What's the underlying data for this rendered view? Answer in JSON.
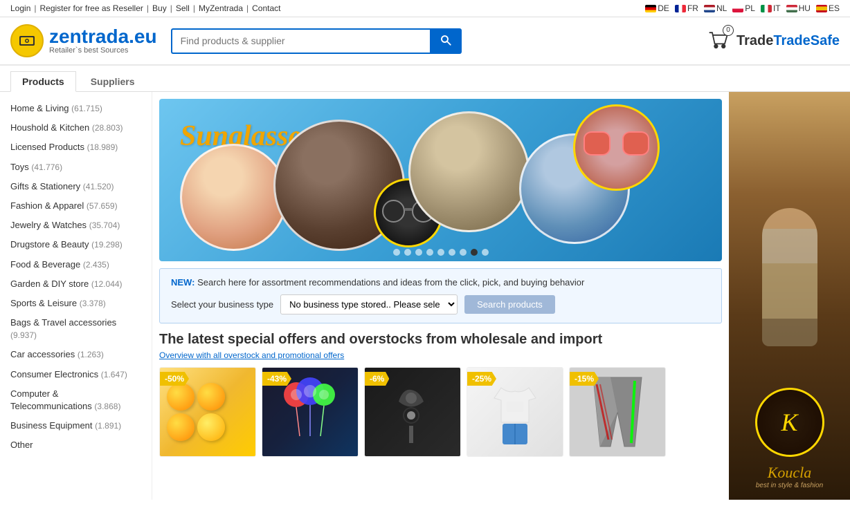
{
  "topbar": {
    "links": [
      "Login",
      "Register for free as Reseller",
      "Buy",
      "Sell",
      "MyZentrada",
      "Contact"
    ],
    "separators": [
      "|",
      "|",
      "|",
      "|",
      "|"
    ],
    "langs": [
      {
        "code": "DE",
        "flag_color": "#000 #dd0000 #ffcc00"
      },
      {
        "code": "FR",
        "flag_color": "#002395 #fff #ed2939"
      },
      {
        "code": "NL",
        "flag_color": "#ae1c28 #fff #21468b"
      },
      {
        "code": "PL",
        "flag_color": "#fff #dc143c"
      },
      {
        "code": "IT",
        "flag_color": "#009246 #fff #ce2b37"
      },
      {
        "code": "HU",
        "flag_color": "#ce2939 #fff #436f4d"
      },
      {
        "code": "ES",
        "flag_color": "#c60b1e #f1bf00 #c60b1e"
      }
    ]
  },
  "header": {
    "logo_brand": "zentrada",
    "logo_tld": ".eu",
    "logo_tagline": "Retailer`s best Sources",
    "search_placeholder": "Find products & supplier",
    "cart_count": "0",
    "tradesafe": "TradeSafe"
  },
  "nav": {
    "tabs": [
      "Products",
      "Suppliers"
    ],
    "active_tab": 0
  },
  "sidebar": {
    "items": [
      {
        "label": "Home & Living",
        "count": "61.715"
      },
      {
        "label": "Houshold & Kitchen",
        "count": "28.803"
      },
      {
        "label": "Licensed Products",
        "count": "18.989"
      },
      {
        "label": "Toys",
        "count": "41.776"
      },
      {
        "label": "Gifts & Stationery",
        "count": "41.520"
      },
      {
        "label": "Fashion & Apparel",
        "count": "57.659"
      },
      {
        "label": "Jewelry & Watches",
        "count": "35.704"
      },
      {
        "label": "Drugstore & Beauty",
        "count": "19.298"
      },
      {
        "label": "Food & Beverage",
        "count": "2.435"
      },
      {
        "label": "Garden & DIY store",
        "count": "12.044"
      },
      {
        "label": "Sports & Leisure",
        "count": "3.378"
      },
      {
        "label": "Bags & Travel accessories",
        "count": "9.937"
      },
      {
        "label": "Car accessories",
        "count": "1.263"
      },
      {
        "label": "Consumer Electronics",
        "count": "1.647"
      },
      {
        "label": "Computer & Telecommunications",
        "count": "3.868"
      },
      {
        "label": "Business Equipment",
        "count": "1.891"
      },
      {
        "label": "Other",
        "count": ""
      }
    ]
  },
  "banner": {
    "text": "Sunglasses",
    "dots_count": 9,
    "active_dot": 7
  },
  "new_section": {
    "new_label": "NEW:",
    "text": "Search here for assortment recommendations and ideas from the click, pick, and buying behavior",
    "sub_text": "Select your business type",
    "dropdown_default": "No business type stored.. Please sele",
    "button_label": "Search products"
  },
  "offers": {
    "title": "The latest special offers and overstocks from wholesale and import",
    "link_text": "Overview with all overstock and promotional offers",
    "items": [
      {
        "badge": "-50%",
        "badge_type": "yellow"
      },
      {
        "badge": "-43%",
        "badge_type": "yellow"
      },
      {
        "badge": "-6%",
        "badge_type": "yellow"
      },
      {
        "badge": "-25%",
        "badge_type": "yellow"
      },
      {
        "badge": "-15%",
        "badge_type": "yellow"
      }
    ]
  },
  "right_ad": {
    "brand": "K",
    "tagline": "best in style & fashion"
  },
  "icons": {
    "search": "🔍",
    "cart": "🛒"
  }
}
